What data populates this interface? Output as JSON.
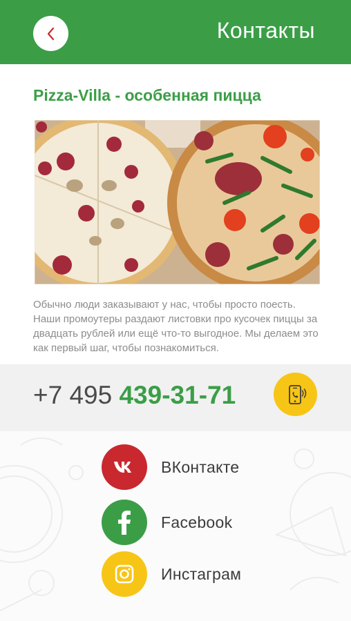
{
  "header": {
    "back_icon": "chevron-left-icon",
    "title": "Контакты",
    "color": "#3b9e47"
  },
  "content": {
    "title": "Pizza-Villa - особенная пицца",
    "image": "pizza-photo",
    "description": "Обычно люди заказывают у нас, чтобы просто поесть. Наши промоутеры раздают листовки про кусочек пиццы за двадцать рублей или ещё что-то выгодное. Мы делаем это как первый шаг, чтобы познакомиться."
  },
  "phone": {
    "prefix": "+7 495 ",
    "number": "439-31-71",
    "call_icon": "phone-call-icon",
    "accent": "#f7c515"
  },
  "social": [
    {
      "label": "ВКонтакте",
      "icon": "vk-icon",
      "color": "#c9282f"
    },
    {
      "label": "Facebook",
      "icon": "facebook-icon",
      "color": "#3b9e47"
    },
    {
      "label": "Инстаграм",
      "icon": "instagram-icon",
      "color": "#f7c515"
    }
  ]
}
